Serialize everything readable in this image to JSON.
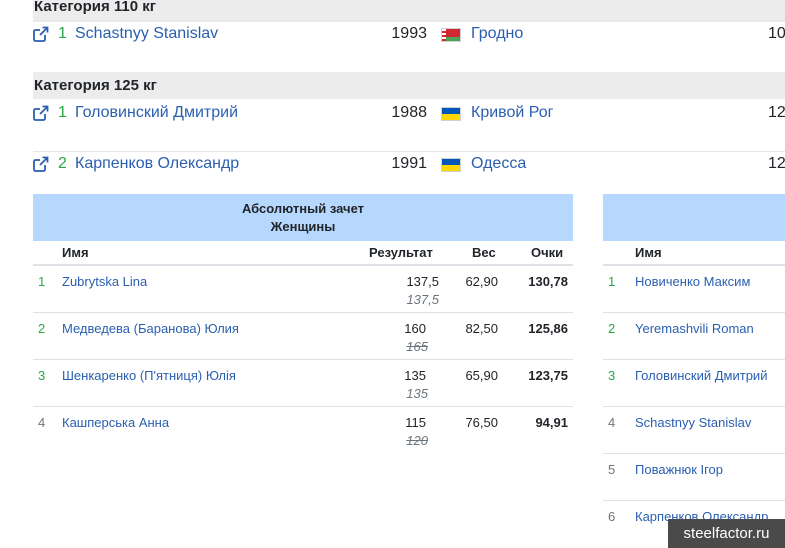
{
  "categories": [
    {
      "title": "Категория 110 кг",
      "athletes": [
        {
          "place": "1",
          "name": "Schastnyy Stanislav",
          "year": "1993",
          "flag": "by",
          "city": "Гродно",
          "cut": "10"
        }
      ]
    },
    {
      "title": "Категория 125 кг",
      "athletes": [
        {
          "place": "1",
          "name": "Головинский Дмитрий",
          "year": "1988",
          "flag": "ua",
          "city": "Кривой Рог",
          "cut": "12"
        },
        {
          "place": "2",
          "name": "Карпенков Олександр",
          "year": "1991",
          "flag": "ua",
          "city": "Одесса",
          "cut": "12"
        }
      ]
    }
  ],
  "women_table": {
    "title_line1": "Абсолютный зачет",
    "title_line2": "Женщины",
    "headers": {
      "name": "Имя",
      "result": "Результат",
      "weight": "Вес",
      "points": "Очки"
    },
    "rows": [
      {
        "place": "1",
        "name": "Zubrytska Lina",
        "result": "137,5",
        "result2": "137,5",
        "result2_struck": false,
        "weight": "62,90",
        "points": "130,78"
      },
      {
        "place": "2",
        "name": "Медведева (Баранова) Юлия",
        "result": "160",
        "result2": "165",
        "result2_struck": true,
        "weight": "82,50",
        "points": "125,86"
      },
      {
        "place": "3",
        "name": "Шенкаренко (П'ятниця) Юлія",
        "result": "135",
        "result2": "135",
        "result2_struck": false,
        "weight": "65,90",
        "points": "123,75"
      },
      {
        "place": "4",
        "name": "Кашперська Анна",
        "result": "115",
        "result2": "120",
        "result2_struck": true,
        "weight": "76,50",
        "points": "94,91"
      }
    ]
  },
  "men_table": {
    "headers": {
      "name": "Имя"
    },
    "rows": [
      {
        "place": "1",
        "name": "Новиченко Максим"
      },
      {
        "place": "2",
        "name": "Yeremashvili Roman"
      },
      {
        "place": "3",
        "name": "Головинский Дмитрий"
      },
      {
        "place": "4",
        "name": "Schastnyy Stanislav"
      },
      {
        "place": "5",
        "name": "Поважнюк Ігор"
      },
      {
        "place": "6",
        "name": "Карпенков Олександр"
      }
    ]
  },
  "watermark": "steelfactor.ru",
  "colors": {
    "link": "#2a5fb0",
    "place_top": "#28a745",
    "table_head": "#b7d8fe",
    "category_bg": "#ececec"
  }
}
